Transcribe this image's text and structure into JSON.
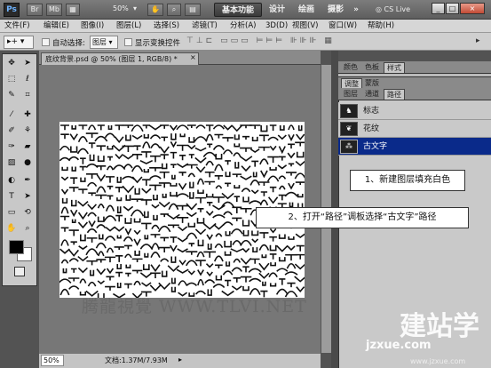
{
  "titlebar": {
    "logo": "Ps",
    "zoom": "50%",
    "workspaces": [
      "基本功能",
      "设计",
      "绘画",
      "摄影"
    ],
    "more": "»",
    "cslive": "CS Live",
    "window_buttons": [
      "_",
      "□",
      "×"
    ]
  },
  "menu": [
    "文件(F)",
    "编辑(E)",
    "图像(I)",
    "图层(L)",
    "选择(S)",
    "滤镜(T)",
    "分析(A)",
    "3D(D)",
    "视图(V)",
    "窗口(W)",
    "帮助(H)"
  ],
  "options": {
    "auto_select_label": "自动选择:",
    "auto_select_value": "图层",
    "show_transform_label": "显示变换控件"
  },
  "document": {
    "tab_title": "底纹背景.psd @ 50% (图层 1, RGB/8) *",
    "zoom": "50%",
    "doc_size": "文档:1.37M/7.93M"
  },
  "panels": {
    "top_tabs": [
      "颜色",
      "色板",
      "样式"
    ],
    "mid_tabs": [
      "调整",
      "蒙版"
    ],
    "paths_tabs": [
      "图层",
      "通道",
      "路径"
    ],
    "paths": [
      "标志",
      "花纹",
      "古文字"
    ],
    "selected_path": 2
  },
  "callouts": {
    "step1": "1、新建图层填充白色",
    "step2": "2、打开“路径”调板选择“古文字”路径"
  },
  "watermark": {
    "text": "腾龍視覺 WWW.TLVI.NET",
    "logo": "建站学",
    "url": "jzxue.com",
    "small": "www.jzxue.com"
  },
  "colors": {
    "selected_row": "#0a2a8a",
    "workspace_active": "#3a3a3a"
  }
}
